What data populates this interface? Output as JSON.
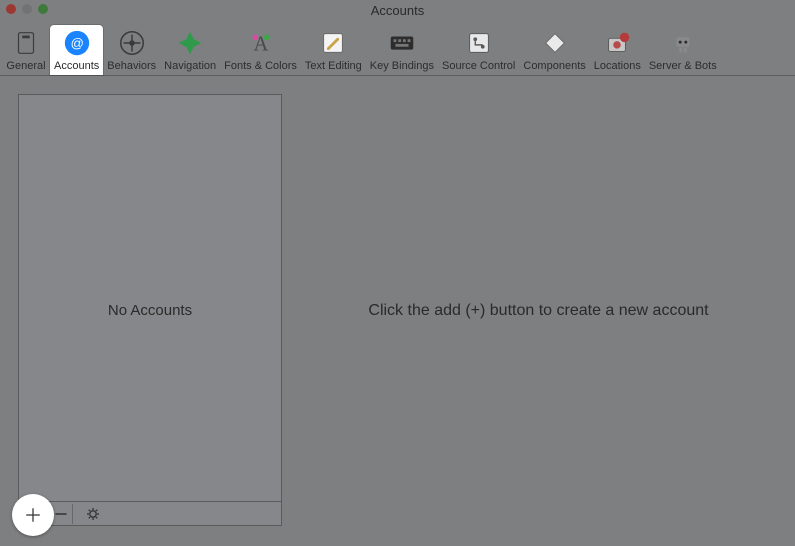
{
  "window": {
    "title": "Accounts"
  },
  "toolbar": {
    "tabs": [
      {
        "label": "General"
      },
      {
        "label": "Accounts"
      },
      {
        "label": "Behaviors"
      },
      {
        "label": "Navigation"
      },
      {
        "label": "Fonts & Colors"
      },
      {
        "label": "Text Editing"
      },
      {
        "label": "Key Bindings"
      },
      {
        "label": "Source Control"
      },
      {
        "label": "Components"
      },
      {
        "label": "Locations"
      },
      {
        "label": "Server & Bots"
      }
    ],
    "selected_index": 1
  },
  "sidebar": {
    "empty_label": "No Accounts"
  },
  "detail": {
    "empty_hint": "Click the add (+) button to create a new account"
  }
}
